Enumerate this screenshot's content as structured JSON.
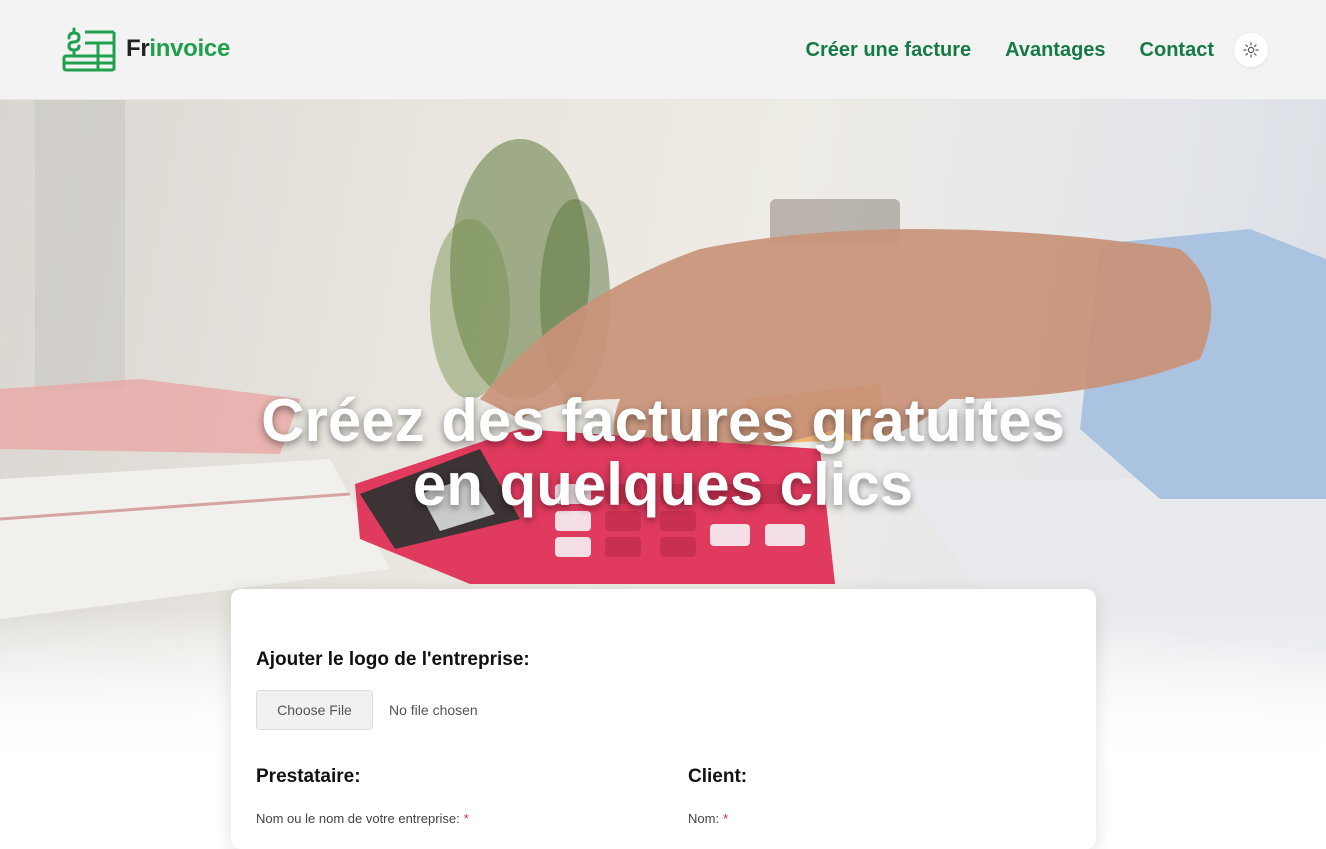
{
  "brand": {
    "prefix": "Fr",
    "suffix": "invoice",
    "accent_color": "#1fa04c"
  },
  "nav": {
    "items": [
      {
        "label": "Créer une facture"
      },
      {
        "label": "Avantages"
      },
      {
        "label": "Contact"
      }
    ],
    "link_color": "#157a45",
    "theme_toggle_icon": "sun-icon"
  },
  "hero": {
    "title_line1": "Créez des factures gratuites",
    "title_line2": "en quelques clics"
  },
  "form": {
    "logo_section_title": "Ajouter le logo de l'entreprise:",
    "file_button_label": "Choose File",
    "file_status": "No file chosen",
    "provider": {
      "title": "Prestataire:",
      "name_label": "Nom ou le nom de votre entreprise:",
      "required_mark": "*"
    },
    "client": {
      "title": "Client:",
      "name_label": "Nom:",
      "required_mark": "*"
    }
  }
}
